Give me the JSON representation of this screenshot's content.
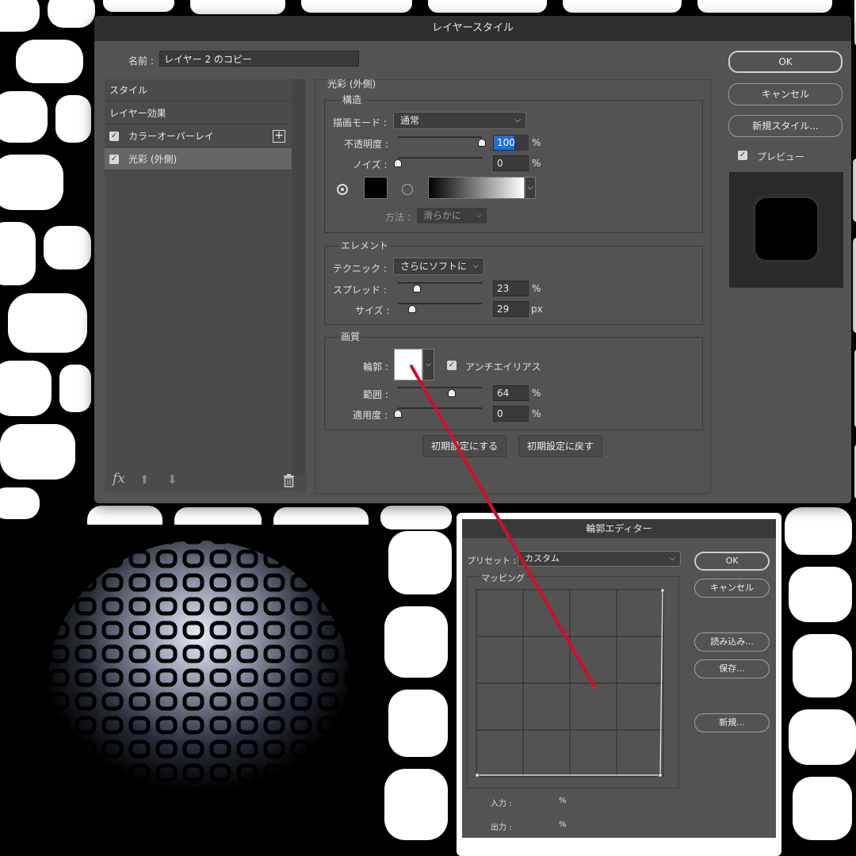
{
  "dialog": {
    "title": "レイヤースタイル",
    "name_label": "名前 :",
    "name_value": "レイヤー 2 のコピー",
    "ok": "OK",
    "cancel": "キャンセル",
    "new_style": "新規スタイル...",
    "preview_label": "プレビュー",
    "preview_checked": true
  },
  "styles_list": {
    "header": "スタイル",
    "items": [
      {
        "label": "レイヤー効果",
        "checkbox": false
      },
      {
        "label": "カラーオーバーレイ",
        "checkbox": true,
        "add_icon": "plus-box-icon"
      },
      {
        "label": "光彩 (外側)",
        "checkbox": true,
        "active": true
      }
    ],
    "footer_icons": [
      "fx-icon",
      "arrow-up-icon",
      "arrow-down-icon",
      "trash-icon"
    ],
    "fx_text": "fx"
  },
  "outer_glow": {
    "section_title": "光彩 (外側)",
    "structure": {
      "title": "構造",
      "blend_mode_label": "描画モード :",
      "blend_mode": "通常",
      "opacity_label": "不透明度 :",
      "opacity": "100",
      "opacity_unit": "%",
      "noise_label": "ノイズ :",
      "noise": "0",
      "noise_unit": "%",
      "method_label": "方法 :",
      "method": "滑らかに"
    },
    "elements": {
      "title": "エレメント",
      "technique_label": "テクニック :",
      "technique": "さらにソフトに",
      "spread_label": "スプレッド :",
      "spread": "23",
      "spread_unit": "%",
      "size_label": "サイズ :",
      "size": "29",
      "size_unit": "px"
    },
    "quality": {
      "title": "画質",
      "contour_label": "輪郭 :",
      "antialias_label": "アンチエイリアス",
      "antialias_checked": true,
      "range_label": "範囲 :",
      "range": "64",
      "range_unit": "%",
      "jitter_label": "適用度 :",
      "jitter": "0",
      "jitter_unit": "%"
    },
    "make_default": "初期設定にする",
    "reset_default": "初期設定に戻す"
  },
  "contour_editor": {
    "title": "輪郭エディター",
    "preset_label": "プリセット :",
    "preset": "カスタム",
    "mapping_label": "マッピング",
    "input_label": "入力 :",
    "input_unit": "%",
    "output_label": "出力 :",
    "output_unit": "%",
    "ok": "OK",
    "cancel": "キャンセル",
    "load": "読み込み...",
    "save": "保存...",
    "new": "新規..."
  },
  "colors": {
    "panel": "#535353",
    "accent_selection": "#1f6fd6",
    "annotation_line": "#d0102a"
  }
}
